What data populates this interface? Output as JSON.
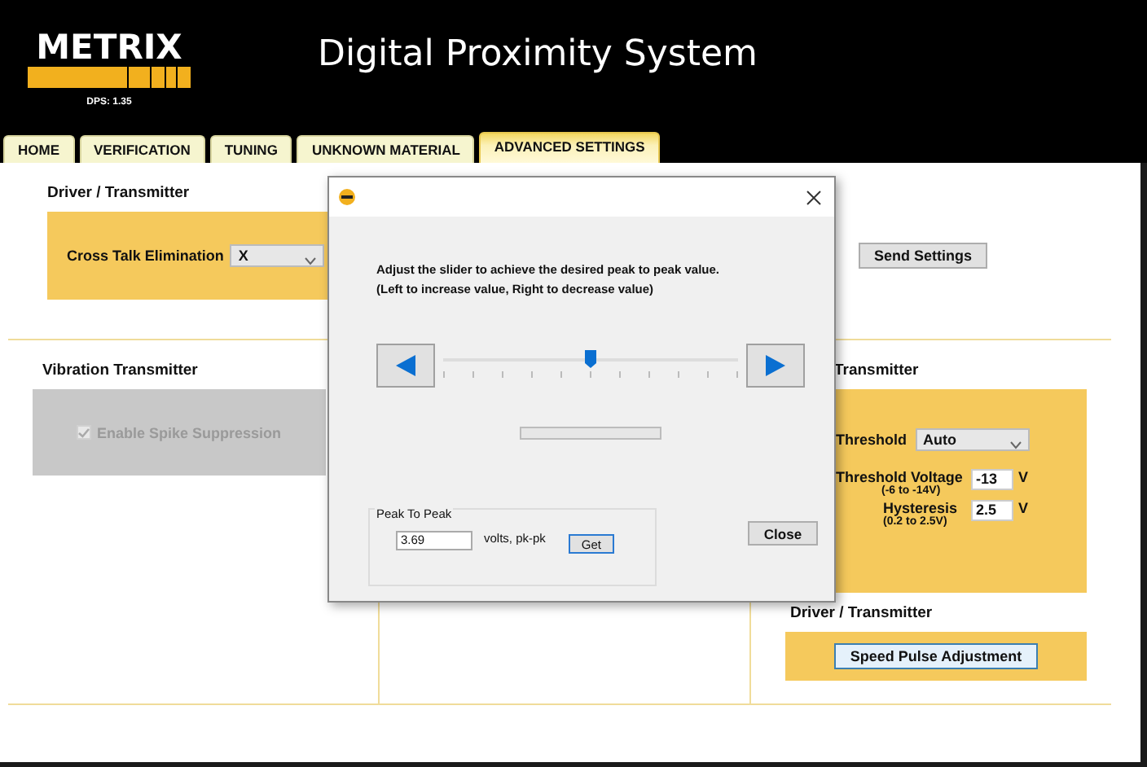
{
  "header": {
    "logo": "METRIX",
    "version": "DPS: 1.35",
    "title": "Digital Proximity System"
  },
  "tabs": [
    {
      "label": "HOME",
      "selected": false
    },
    {
      "label": "VERIFICATION",
      "selected": false
    },
    {
      "label": "TUNING",
      "selected": false
    },
    {
      "label": "UNKNOWN MATERIAL",
      "selected": false
    },
    {
      "label": "ADVANCED SETTINGS",
      "selected": true
    }
  ],
  "driver_section": {
    "heading": "Driver / Transmitter",
    "cross_talk": {
      "label": "Cross Talk Elimination",
      "value": "X"
    },
    "send_button": "Send Settings"
  },
  "vibration_section": {
    "heading": "Vibration Transmitter",
    "spike": {
      "label": "Enable Spike Suppression",
      "checked": true,
      "disabled": true
    }
  },
  "transmitter_section": {
    "heading": "Transmitter",
    "threshold": {
      "label": "Threshold",
      "value": "Auto"
    },
    "threshold_voltage": {
      "label": "Threshold Voltage",
      "hint": "(-6 to -14V)",
      "value": "-13",
      "unit": "V"
    },
    "hysteresis": {
      "label": "Hysteresis",
      "hint": "(0.2 to 2.5V)",
      "value": "2.5",
      "unit": "V"
    }
  },
  "pulse_section": {
    "heading": "Driver / Transmitter",
    "button": "Speed Pulse Adjustment"
  },
  "dialog": {
    "instructions": [
      "Adjust the slider to achieve the desired peak to peak value.",
      "(Left to increase value, Right to decrease value)"
    ],
    "slider": {
      "level": 0.5
    },
    "progress": {
      "level": 0
    },
    "peak_group": {
      "title": "Peak To Peak",
      "value": "3.69",
      "unit": "volts, pk-pk",
      "get_button": "Get"
    },
    "close_button": "Close"
  }
}
